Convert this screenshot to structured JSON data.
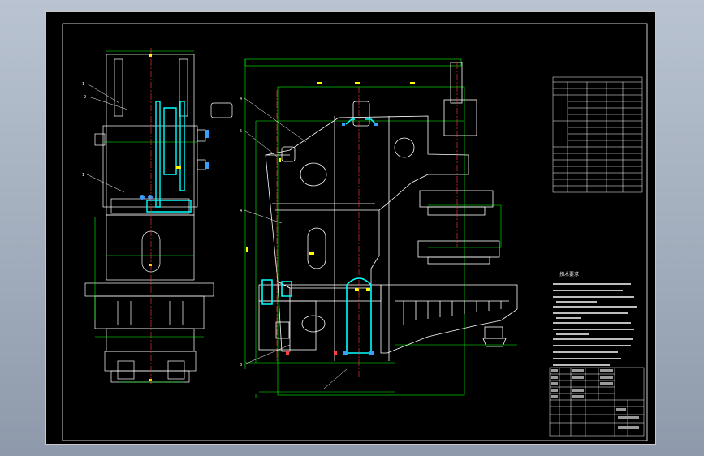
{
  "colors": {
    "background": "#000000",
    "frame": "#ffffff",
    "outline": "#ffffff",
    "dimension": "#00ff00",
    "center_line": "#ff4040",
    "hatch": "#00ffff",
    "marker": "#ffff00",
    "blue_part": "#3aa0ff"
  },
  "part_balloons": {
    "side_view": [
      "1",
      "2",
      "1"
    ],
    "front_view": [
      "4",
      "5",
      "4",
      "3"
    ]
  },
  "spec_table": {
    "rows": 13,
    "cols": 5
  },
  "notes": {
    "heading": "技术要求",
    "line_count": 15
  },
  "title_block": {
    "rows": 8,
    "cols": 6
  }
}
